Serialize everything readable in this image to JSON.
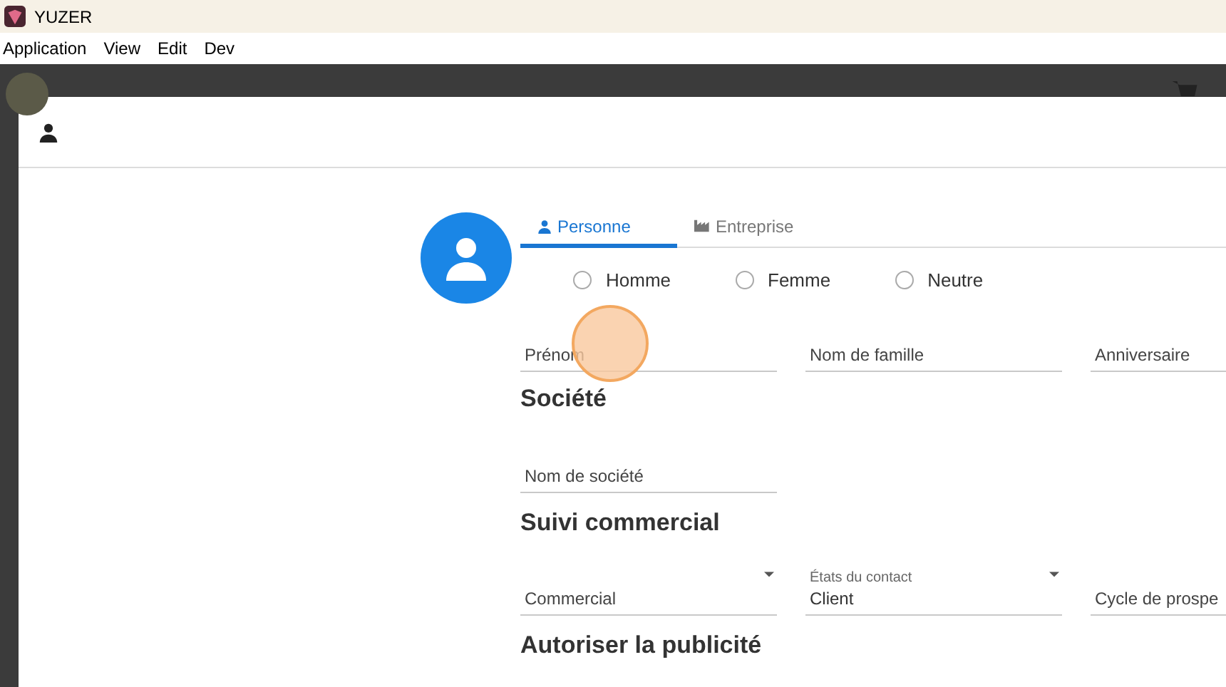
{
  "window": {
    "title": "YUZER"
  },
  "menu": [
    "Application",
    "View",
    "Edit",
    "Dev"
  ],
  "tabs": [
    {
      "label": "Personne",
      "kind": "person",
      "selected": true
    },
    {
      "label": "Entreprise",
      "kind": "company",
      "selected": false
    }
  ],
  "gender": [
    {
      "label": "Homme",
      "selected": false
    },
    {
      "label": "Femme",
      "selected": false
    },
    {
      "label": "Neutre",
      "selected": false
    }
  ],
  "identity_fields": [
    {
      "placeholder": "Prénom"
    },
    {
      "placeholder": "Nom de famille"
    },
    {
      "placeholder": "Anniversaire"
    }
  ],
  "company_section": {
    "title": "Société",
    "fields": [
      {
        "placeholder": "Nom de société"
      }
    ]
  },
  "sales_section": {
    "title": "Suivi commercial",
    "fields": [
      {
        "kind": "select",
        "placeholder": "Commercial"
      },
      {
        "kind": "select",
        "label": "États du contact",
        "value": "Client"
      },
      {
        "kind": "text",
        "placeholder": "Cycle de prospe"
      }
    ]
  },
  "ads_section": {
    "title": "Autoriser la publicité"
  }
}
